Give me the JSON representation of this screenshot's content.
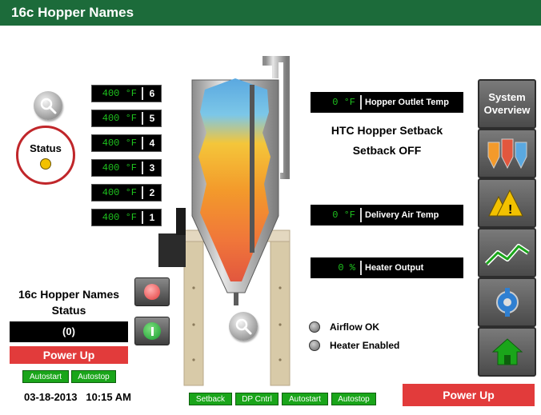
{
  "title": "16c Hopper Names",
  "status_label": "Status",
  "zones": [
    {
      "value": "400 °F",
      "number": "6"
    },
    {
      "value": "400 °F",
      "number": "5"
    },
    {
      "value": "400 °F",
      "number": "4"
    },
    {
      "value": "400 °F",
      "number": "3"
    },
    {
      "value": "400 °F",
      "number": "2"
    },
    {
      "value": "400 °F",
      "number": "1"
    }
  ],
  "readouts": {
    "outlet": {
      "value": "0 °F",
      "label": "Hopper Outlet Temp"
    },
    "delivery": {
      "value": "0 °F",
      "label": "Delivery Air Temp"
    },
    "heater": {
      "value": "0 %",
      "label": "Heater Output"
    }
  },
  "setback": {
    "title": "HTC Hopper Setback",
    "state": "Setback OFF"
  },
  "hopper_panel": {
    "name": "16c Hopper Names",
    "status": "Status",
    "value": "(0)",
    "power": "Power Up"
  },
  "left_buttons": [
    "Autostart",
    "Autostop"
  ],
  "datetime": {
    "date": "03-18-2013",
    "time": "10:15 AM"
  },
  "bottom_buttons": [
    "Setback",
    "DP Cntrl",
    "Autostart",
    "Autostop"
  ],
  "bottom_power": "Power Up",
  "indicators": [
    {
      "label": "Airflow OK"
    },
    {
      "label": "Heater Enabled"
    }
  ],
  "nav": {
    "system_overview": "System Overview"
  },
  "colors": {
    "title_bar": "#1c6b3a",
    "readout_text": "#1ec21e",
    "power_bar": "#e23b3b",
    "status_led": "#f2c100",
    "status_ring": "#c0262a"
  }
}
